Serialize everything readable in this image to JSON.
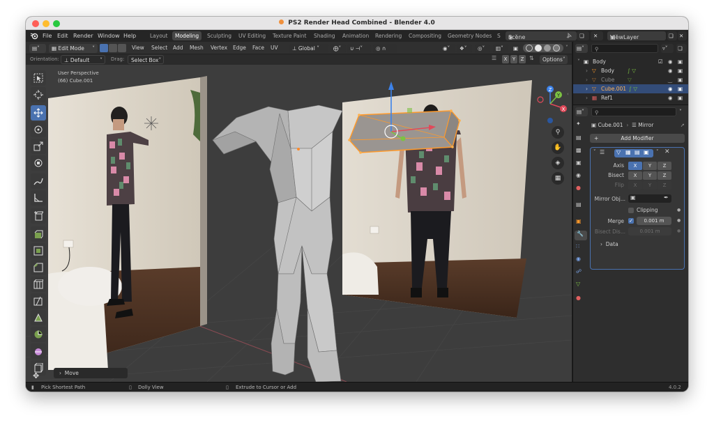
{
  "window": {
    "title": "PS2 Render Head Combined - Blender 4.0",
    "traffic_lights": {
      "close": "#fe5f57",
      "minimize": "#febc2e",
      "zoom": "#28c840"
    }
  },
  "menu": {
    "file": "File",
    "edit": "Edit",
    "render": "Render",
    "window": "Window",
    "help": "Help"
  },
  "workspaces": [
    "Layout",
    "Modeling",
    "Sculpting",
    "UV Editing",
    "Texture Paint",
    "Shading",
    "Animation",
    "Rendering",
    "Compositing",
    "Geometry Nodes",
    "S"
  ],
  "active_workspace": "Modeling",
  "scene": {
    "scene_name": "Scene",
    "view_layer": "ViewLayer"
  },
  "header": {
    "mode": "Edit Mode",
    "menus": {
      "view": "View",
      "select": "Select",
      "add": "Add",
      "mesh": "Mesh",
      "vertex": "Vertex",
      "edge": "Edge",
      "face": "Face",
      "uv": "UV"
    },
    "transform_orientation": "Global",
    "options_label": "Options",
    "mirror_axes": [
      "X",
      "Y",
      "Z"
    ]
  },
  "subheader": {
    "orientation_label": "Orientation:",
    "orientation_value": "Default",
    "drag_label": "Drag:",
    "drag_value": "Select Box"
  },
  "viewport": {
    "perspective_label": "User Perspective",
    "object_label": "(66) Cube.001",
    "last_operator": "Move",
    "gizmo_axes": {
      "z": "Z",
      "y": "Y",
      "x": "X"
    }
  },
  "outliner": {
    "search_placeholder": "",
    "items": [
      {
        "name": "Body",
        "type": "collection"
      },
      {
        "name": "Body",
        "type": "mesh"
      },
      {
        "name": "Cube",
        "type": "mesh"
      },
      {
        "name": "Cube.001",
        "type": "mesh",
        "selected": true
      },
      {
        "name": "Ref1",
        "type": "image"
      }
    ]
  },
  "properties": {
    "search_placeholder": "",
    "breadcrumb_object": "Cube.001",
    "breadcrumb_modifier": "Mirror",
    "add_modifier_label": "Add Modifier",
    "mirror": {
      "axis_label": "Axis",
      "bisect_label": "Bisect",
      "flip_label": "Flip",
      "axis_buttons": [
        "X",
        "Y",
        "Z"
      ],
      "mirror_object_label": "Mirror Obj...",
      "clipping_label": "Clipping",
      "merge_label": "Merge",
      "merge_value": "0.001 m",
      "bisect_distance_label": "Bisect Dis...",
      "bisect_distance_value": "0.001 m",
      "data_label": "Data"
    }
  },
  "statusbar": {
    "left": "Pick Shortest Path",
    "middle": "Dolly View",
    "right": "Extrude to Cursor or Add",
    "version": "4.0.2"
  },
  "colors": {
    "accent": "#4a72b0",
    "selection_orange": "#ff9a2b",
    "axis_x": "#e04a5a",
    "axis_y": "#7cc243",
    "axis_z": "#3c82ea"
  }
}
